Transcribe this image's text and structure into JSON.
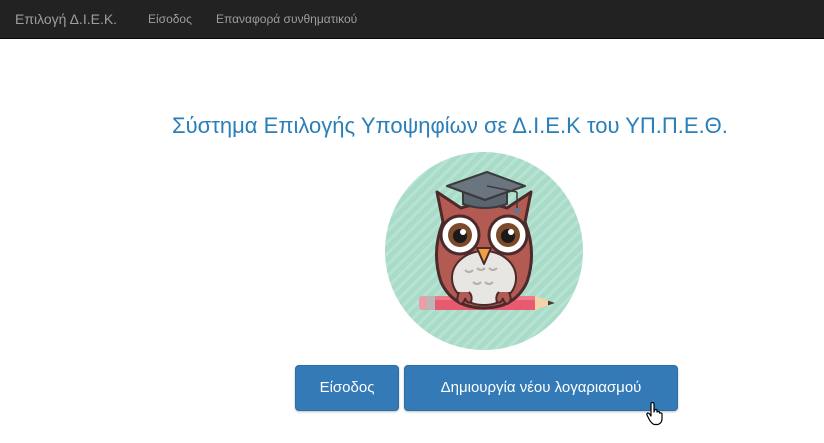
{
  "navbar": {
    "brand": "Επιλογή Δ.Ι.Ε.Κ.",
    "links": [
      {
        "label": "Είσοδος"
      },
      {
        "label": "Επαναφορά συνθηματικού"
      }
    ]
  },
  "main": {
    "title": "Σύστημα Επιλογής Υποψηφίων σε Δ.Ι.Ε.Κ του ΥΠ.Π.Ε.Θ.",
    "logo": {
      "icon": "owl-graduate-icon",
      "circle_color": "#a9dbc9"
    },
    "buttons": {
      "login_label": "Είσοδος",
      "create_account_label": "Δημιουργία νέου λογαριασμού"
    }
  },
  "colors": {
    "navbar_bg": "#222222",
    "navbar_text": "#9d9d9d",
    "title": "#2a7fb8",
    "button_bg": "#337ab7"
  }
}
